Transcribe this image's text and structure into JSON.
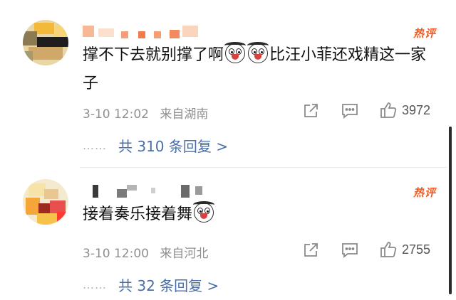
{
  "comments": [
    {
      "username": "",
      "hot_badge": "热评",
      "text_parts": [
        "撑不下去就别撑了啊",
        "比汪小菲还戏精这一家子"
      ],
      "emoji_names": [
        "husky-emoji",
        "husky-emoji"
      ],
      "time": "3-10 12:02",
      "location": "来自湖南",
      "like_count": "3972",
      "reply_dots": "……",
      "reply_label": "共 310 条回复 >"
    },
    {
      "username": "",
      "hot_badge": "热评",
      "text_parts": [
        "接着奏乐接着舞"
      ],
      "emoji_names": [
        "husky-emoji"
      ],
      "time": "3-10 12:00",
      "location": "来自河北",
      "like_count": "2755",
      "reply_dots": "……",
      "reply_label": "共 32 条回复 >"
    }
  ],
  "icons": {
    "share": "share-icon",
    "comment": "comment-icon",
    "like": "thumbs-up-icon"
  },
  "colors": {
    "hot_badge": "#ef5a28",
    "reply_link": "#4a6fa8",
    "meta_text": "#8f8f8f"
  }
}
